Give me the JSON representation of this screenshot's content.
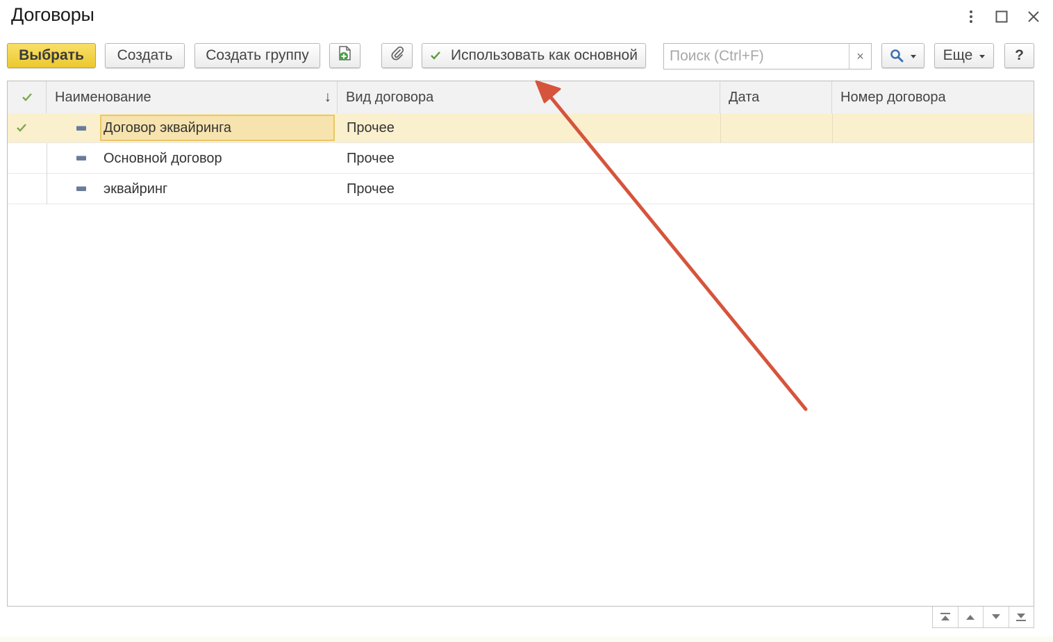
{
  "window": {
    "title": "Договоры",
    "controls": [
      "more-icon",
      "maximize-icon",
      "close-icon"
    ]
  },
  "toolbar": {
    "select_label": "Выбрать",
    "create_label": "Создать",
    "create_group_label": "Создать группу",
    "copy_icon": "document-add-icon",
    "attach_icon": "paperclip-icon",
    "use_as_main_label": "Использовать как основной",
    "search_placeholder": "Поиск (Ctrl+F)",
    "search_value": "",
    "clear_label": "×",
    "search_icon": "magnifier-icon",
    "more_label": "Еще",
    "help_label": "?"
  },
  "table": {
    "columns": [
      {
        "key": "mark",
        "label": ""
      },
      {
        "key": "name",
        "label": "Наименование"
      },
      {
        "key": "kind",
        "label": "Вид договора"
      },
      {
        "key": "date",
        "label": "Дата"
      },
      {
        "key": "number",
        "label": "Номер договора"
      }
    ],
    "sort_indicator": "↓",
    "rows": [
      {
        "main": true,
        "name": "Договор эквайринга",
        "kind": "Прочее",
        "date": "",
        "number": "",
        "selected": true
      },
      {
        "main": false,
        "name": "Основной договор",
        "kind": "Прочее",
        "date": "",
        "number": "",
        "selected": false
      },
      {
        "main": false,
        "name": "эквайринг",
        "kind": "Прочее",
        "date": "",
        "number": "",
        "selected": false
      }
    ]
  },
  "navigation": [
    "first-page-icon",
    "prev-page-icon",
    "next-page-icon",
    "last-page-icon"
  ],
  "colors": {
    "accent_yellow": "#ecc92f",
    "selected_row": "#fbf0cd",
    "check_green": "#7ba84a",
    "annotation_arrow": "#d6543c"
  }
}
